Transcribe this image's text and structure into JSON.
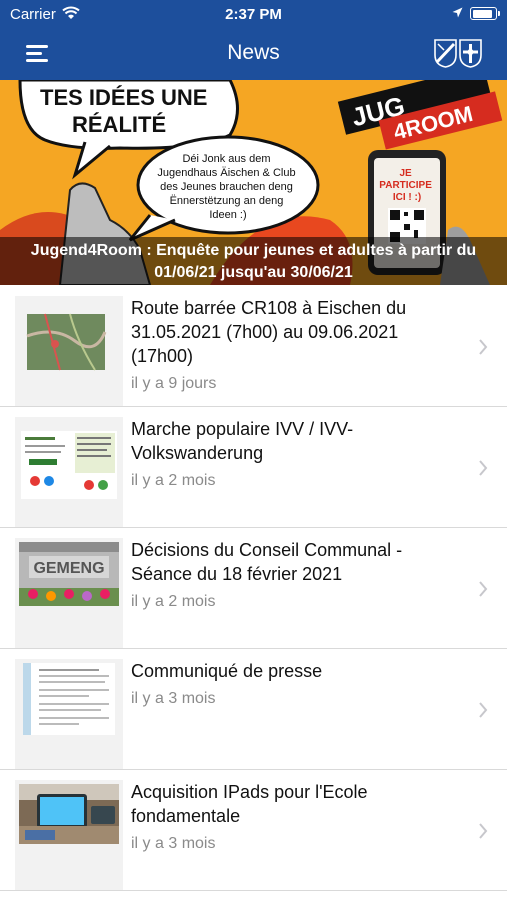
{
  "status_bar": {
    "carrier": "Carrier",
    "time": "2:37 PM",
    "battery_level": 0.95
  },
  "nav": {
    "title": "News"
  },
  "banner": {
    "art_text": {
      "line1": "TES IDÉES UNE",
      "line2": "RÉALITÉ",
      "bubble": [
        "Déi Jonk aus dem",
        "Jugendhaus Äischen & Club",
        "des Jeunes brauchen deng",
        "Ënnerstëtzung an deng",
        "Ideen :)"
      ],
      "logo": "JUG",
      "logo2": "4ROOM",
      "phone": [
        "JE",
        "PARTICIPE",
        "ICI ! :)"
      ]
    },
    "caption": "Jugend4Room : Enquête pour jeunes et adultes à partir du 01/06/21 jusqu'au 30/06/21"
  },
  "news": [
    {
      "title": "Route barrée CR108 à Eischen du 31.05.2021 (7h00) au 09.06.2021 (17h00)",
      "date": "il y a 9 jours",
      "thumb": "map"
    },
    {
      "title": "Marche populaire IVV / IVV-Volkswanderung",
      "date": "il y a 2 mois",
      "thumb": "flyer"
    },
    {
      "title": "Décisions du Conseil Communal - Séance du 18 février 2021",
      "date": "il y a 2 mois",
      "thumb": "building",
      "thumb_text": "GEMENG"
    },
    {
      "title": "Communiqué de presse",
      "date": "il y a 3 mois",
      "thumb": "document"
    },
    {
      "title": "Acquisition IPads pour l'Ecole fondamentale",
      "date": "il y a 3 mois",
      "thumb": "tablet"
    }
  ],
  "colors": {
    "nav_bg": "#1d4f9c",
    "banner_bg": "#f5a623",
    "logo_red": "#d62c1f"
  }
}
